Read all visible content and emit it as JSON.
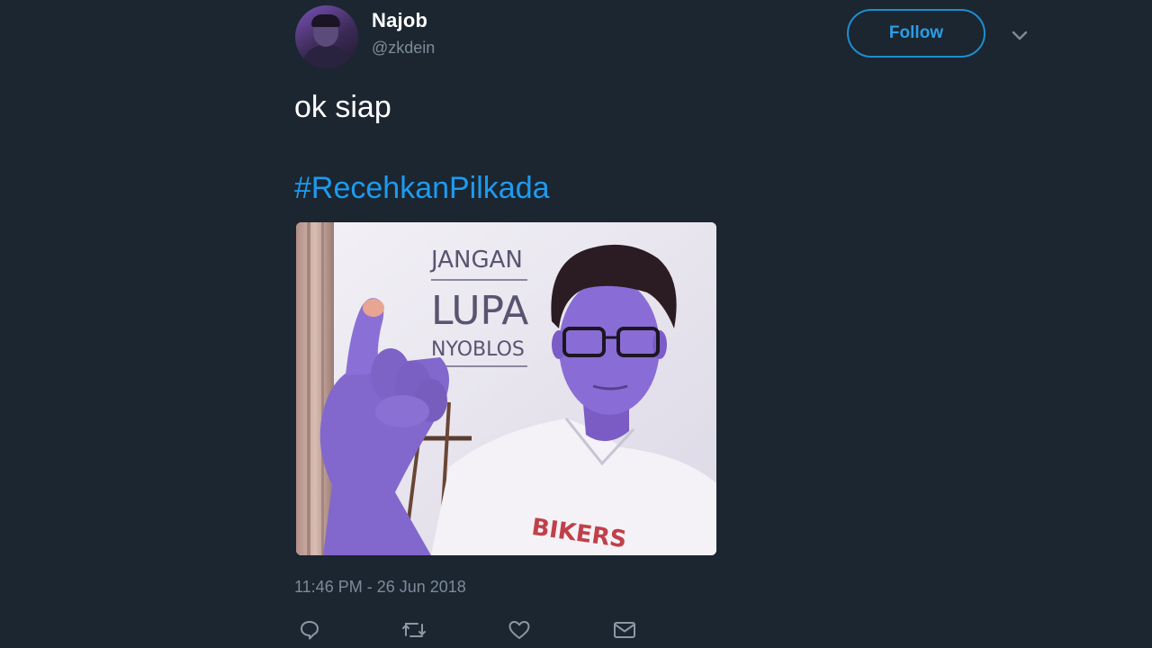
{
  "tweet": {
    "author": {
      "name": "Najob",
      "handle": "@zkdein",
      "avatar_icon": "avatar-image"
    },
    "follow_label": "Follow",
    "menu_icon": "chevron-down-icon",
    "text": "ok siap",
    "hashtag": "#RecehkanPilkada",
    "media": {
      "poster_line1": "JANGAN",
      "poster_line2": "LUPA",
      "poster_line3": "NYOBLOS",
      "shirt_text": "BIKERS"
    },
    "timestamp": "11:46 PM - 26 Jun 2018",
    "actions": {
      "reply_icon": "reply-icon",
      "retweet_icon": "retweet-icon",
      "like_icon": "heart-icon",
      "dm_icon": "envelope-icon"
    }
  },
  "colors": {
    "background": "#1b2631",
    "accent": "#1d9bf0",
    "muted": "#7d8b99"
  }
}
